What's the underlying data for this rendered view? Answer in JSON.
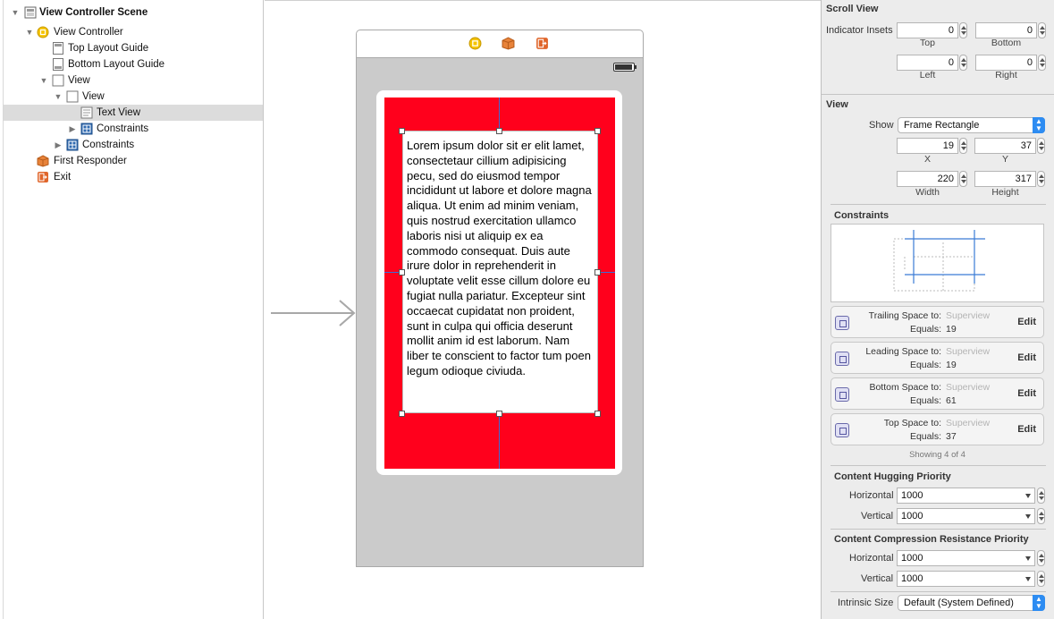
{
  "outline": {
    "items": [
      {
        "label": "View Controller Scene",
        "bold": true
      },
      {
        "label": "View Controller"
      },
      {
        "label": "Top Layout Guide"
      },
      {
        "label": "Bottom Layout Guide"
      },
      {
        "label": "View"
      },
      {
        "label": "View"
      },
      {
        "label": "Text View",
        "selected": true
      },
      {
        "label": "Constraints"
      },
      {
        "label": "Constraints"
      },
      {
        "label": "First Responder"
      },
      {
        "label": "Exit"
      }
    ]
  },
  "canvas": {
    "text_view_content": "Lorem ipsum dolor sit er elit lamet, consectetaur cillium adipisicing pecu, sed do eiusmod tempor incididunt ut labore et dolore magna aliqua. Ut enim ad minim veniam, quis nostrud exercitation ullamco laboris nisi ut aliquip ex ea commodo consequat. Duis aute irure dolor in reprehenderit in voluptate velit esse cillum dolore eu fugiat nulla pariatur. Excepteur sint occaecat cupidatat non proident, sunt in culpa qui officia deserunt mollit anim id est laborum. Nam liber te conscient to factor tum poen legum odioque civiuda.",
    "scene_icons": [
      "view-controller-icon",
      "first-responder-icon",
      "exit-icon"
    ],
    "colors": {
      "red_view": "#ff001c",
      "scene_bg": "#cbcbcb"
    }
  },
  "inspector": {
    "scroll_view": {
      "title": "Scroll View",
      "indicator_insets_label": "Indicator Insets",
      "top": "0",
      "top_label": "Top",
      "bottom": "0",
      "bottom_label": "Bottom",
      "left": "0",
      "left_label": "Left",
      "right": "0",
      "right_label": "Right"
    },
    "view": {
      "title": "View",
      "show_label": "Show",
      "show_value": "Frame Rectangle",
      "x": "19",
      "x_label": "X",
      "y": "37",
      "y_label": "Y",
      "width": "220",
      "width_label": "Width",
      "height": "317",
      "height_label": "Height"
    },
    "constraints": {
      "title": "Constraints",
      "items": [
        {
          "title": "Trailing Space to:",
          "target": "Superview",
          "equals_label": "Equals:",
          "value": "19",
          "edit": "Edit"
        },
        {
          "title": "Leading Space to:",
          "target": "Superview",
          "equals_label": "Equals:",
          "value": "19",
          "edit": "Edit"
        },
        {
          "title": "Bottom Space to:",
          "target": "Superview",
          "equals_label": "Equals:",
          "value": "61",
          "edit": "Edit"
        },
        {
          "title": "Top Space to:",
          "target": "Superview",
          "equals_label": "Equals:",
          "value": "37",
          "edit": "Edit"
        }
      ],
      "showing": "Showing 4 of 4"
    },
    "hugging": {
      "title": "Content Hugging Priority",
      "horizontal_label": "Horizontal",
      "horizontal": "1000",
      "vertical_label": "Vertical",
      "vertical": "1000"
    },
    "compression": {
      "title": "Content Compression Resistance Priority",
      "horizontal_label": "Horizontal",
      "horizontal": "1000",
      "vertical_label": "Vertical",
      "vertical": "1000"
    },
    "intrinsic": {
      "label": "Intrinsic Size",
      "value": "Default (System Defined)"
    }
  }
}
